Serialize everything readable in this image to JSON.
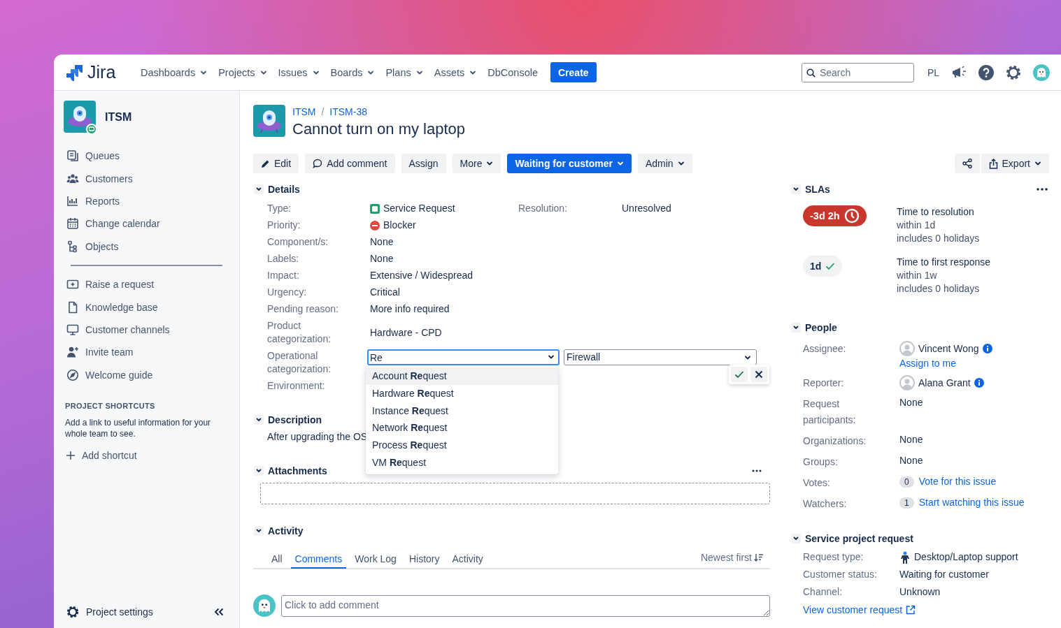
{
  "topbar": {
    "logo": "Jira",
    "nav": [
      {
        "label": "Dashboards",
        "caret": true
      },
      {
        "label": "Projects",
        "caret": true
      },
      {
        "label": "Issues",
        "caret": true
      },
      {
        "label": "Boards",
        "caret": true
      },
      {
        "label": "Plans",
        "caret": true
      },
      {
        "label": "Assets",
        "caret": true
      },
      {
        "label": "DbConsole",
        "caret": false
      }
    ],
    "create": "Create",
    "search": {
      "placeholder": "Search"
    },
    "initials": "PL"
  },
  "sidebar": {
    "project": "ITSM",
    "items": [
      {
        "label": "Queues"
      },
      {
        "label": "Customers"
      },
      {
        "label": "Reports"
      },
      {
        "label": "Change calendar"
      },
      {
        "label": "Objects"
      }
    ],
    "items2": [
      {
        "label": "Raise a request"
      },
      {
        "label": "Knowledge base"
      },
      {
        "label": "Customer channels"
      },
      {
        "label": "Invite team"
      },
      {
        "label": "Welcome guide"
      }
    ],
    "shortcuts_title": "PROJECT SHORTCUTS",
    "shortcuts_text": "Add a link to useful information for your whole team to see.",
    "add_shortcut": "Add shortcut",
    "settings": "Project settings"
  },
  "issue": {
    "breadcrumb": [
      "ITSM",
      "ITSM-38"
    ],
    "breadcrumb_separator": "/",
    "title": "Cannot turn on my laptop",
    "actions": [
      {
        "label": "Edit",
        "kind": "edit",
        "caret": false,
        "primary": false
      },
      {
        "label": "Add comment",
        "kind": "comment",
        "caret": false,
        "primary": false
      },
      {
        "label": "Assign",
        "kind": "plain",
        "caret": false,
        "primary": false
      },
      {
        "label": "More",
        "kind": "plain",
        "caret": true,
        "primary": false
      },
      {
        "label": "Waiting for customer",
        "kind": "plain",
        "caret": true,
        "primary": true
      },
      {
        "label": "Admin",
        "kind": "plain",
        "caret": true,
        "primary": false
      }
    ],
    "export": "Export",
    "details": {
      "heading": "Details",
      "resolution": {
        "label": "Resolution:",
        "value": "Unresolved"
      },
      "fields": [
        {
          "label": "Type:",
          "value": "Service Request",
          "kind": "type"
        },
        {
          "label": "Priority:",
          "value": "Blocker",
          "kind": "priority"
        },
        {
          "label": "Component/s:",
          "value": "None",
          "kind": "text"
        },
        {
          "label": "Labels:",
          "value": "None",
          "kind": "text"
        },
        {
          "label": "Impact:",
          "value": "Extensive / Widespread",
          "kind": "text"
        },
        {
          "label": "Urgency:",
          "value": "Critical",
          "kind": "text"
        },
        {
          "label": "Pending reason:",
          "value": "More info required",
          "kind": "text"
        },
        {
          "label": "Product categorization:",
          "value": "Hardware - CPD",
          "kind": "text"
        },
        {
          "label": "Operational categorization:",
          "kind": "editor",
          "input": "Re",
          "select": "Firewall",
          "suggestions": [
            {
              "text": "Account **Re**quest",
              "selected": true
            },
            {
              "text": "Hardware **Re**quest",
              "selected": false
            },
            {
              "text": "Instance **Re**quest",
              "selected": false
            },
            {
              "text": "Network **Re**quest",
              "selected": false
            },
            {
              "text": "Process **Re**quest",
              "selected": false
            },
            {
              "text": "VM **Re**quest",
              "selected": false
            }
          ]
        },
        {
          "label": "Environment:",
          "kind": "text"
        }
      ]
    },
    "description": {
      "heading": "Description",
      "text": "After upgrading the OS"
    },
    "attachments": {
      "heading": "Attachments"
    },
    "activity": {
      "heading": "Activity",
      "tabs": [
        {
          "label": "All",
          "selected": false
        },
        {
          "label": "Comments",
          "selected": true
        },
        {
          "label": "Work Log",
          "selected": false
        },
        {
          "label": "History",
          "selected": false
        },
        {
          "label": "Activity",
          "selected": false
        }
      ],
      "sort": "Newest first",
      "comment_placeholder": "Click to add comment"
    }
  },
  "side": {
    "slas": {
      "heading": "SLAs",
      "items": [
        {
          "badge": "-3d 2h",
          "kind": "breached",
          "lines": [
            "Time to resolution",
            "within 1d",
            "includes 0 holidays"
          ]
        },
        {
          "badge": "1d",
          "kind": "met",
          "lines": [
            "Time to first response",
            "within 1w",
            "includes 0 holidays"
          ]
        }
      ]
    },
    "people": {
      "heading": "People",
      "fields": [
        {
          "label": "Assignee:",
          "kind": "user",
          "value": "Vincent Wong",
          "link": "Assign to me"
        },
        {
          "label": "Reporter:",
          "kind": "user",
          "value": "Alana Grant"
        },
        {
          "label": "Request participants:",
          "kind": "text",
          "value": "None"
        },
        {
          "label": "Organizations:",
          "kind": "text",
          "value": "None"
        },
        {
          "label": "Groups:",
          "kind": "text",
          "value": "None"
        },
        {
          "label": "Votes:",
          "kind": "count",
          "count": "0",
          "link": "Vote for this issue"
        },
        {
          "label": "Watchers:",
          "kind": "count",
          "count": "1",
          "link": "Start watching this issue"
        }
      ]
    },
    "request": {
      "heading": "Service project request",
      "fields": [
        {
          "label": "Request type:",
          "kind": "request-type",
          "value": "Desktop/Laptop support"
        },
        {
          "label": "Customer status:",
          "kind": "text",
          "value": "Waiting for customer"
        },
        {
          "label": "Channel:",
          "kind": "text",
          "value": "Unknown"
        }
      ],
      "link": "View customer request"
    }
  }
}
